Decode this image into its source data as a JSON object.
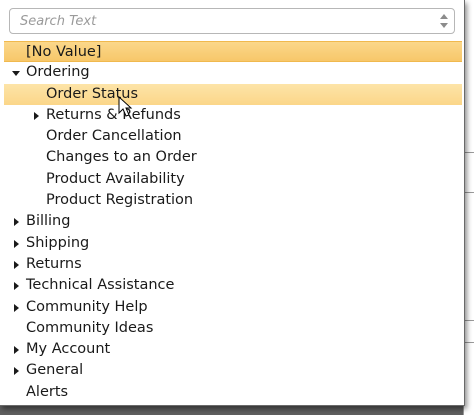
{
  "search": {
    "placeholder": "Search Text",
    "value": ""
  },
  "tree": {
    "no_value": "[No Value]",
    "ordering": "Ordering",
    "order_status": "Order Status",
    "returns_refunds": "Returns & Refunds",
    "order_cancellation": "Order Cancellation",
    "changes_to_order": "Changes to an Order",
    "product_availability": "Product Availability",
    "product_registration": "Product Registration",
    "billing": "Billing",
    "shipping": "Shipping",
    "returns": "Returns",
    "technical_assistance": "Technical Assistance",
    "community_help": "Community Help",
    "community_ideas": "Community Ideas",
    "my_account": "My Account",
    "general": "General",
    "alerts": "Alerts"
  },
  "icons": {
    "collapsed": "triangle-right-icon",
    "expanded": "triangle-down-icon",
    "spinner": "up-down-arrows-icon",
    "cursor": "mouse-pointer-icon"
  },
  "colors": {
    "selected_bg": "#f7c76a",
    "hover_bg": "#fbd689",
    "text": "#1a1a1a",
    "placeholder": "#9a9a9a"
  }
}
